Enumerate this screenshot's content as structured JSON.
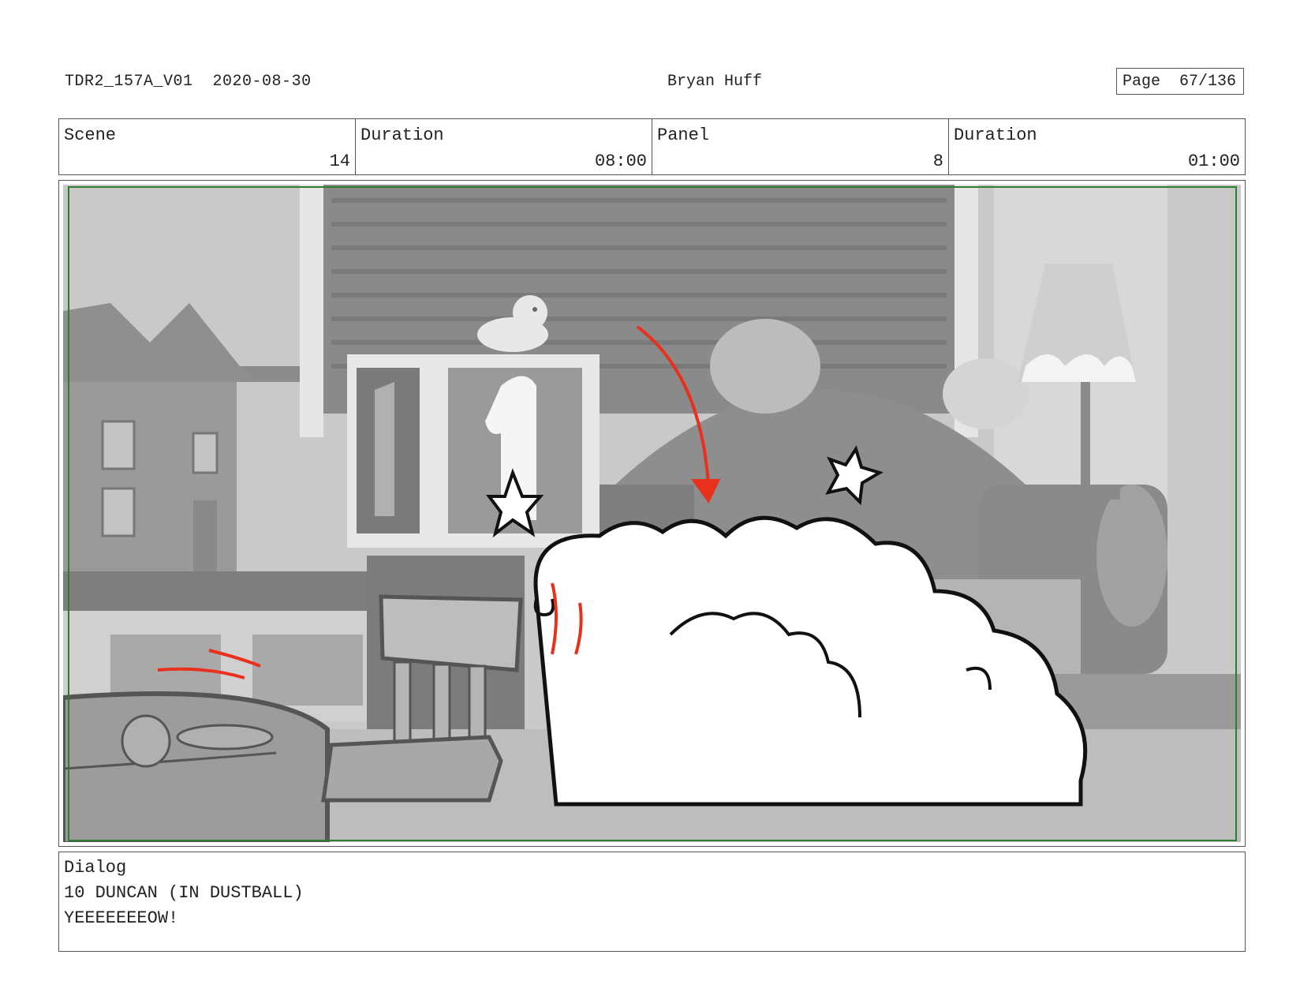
{
  "header": {
    "production_id": "TDR2_157A_V01",
    "date": "2020-08-30",
    "artist": "Bryan Huff",
    "page_label": "Page",
    "page_number": "67/136"
  },
  "info_row": {
    "scene_label": "Scene",
    "scene_value": "14",
    "scene_duration_label": "Duration",
    "scene_duration_value": "08:00",
    "panel_label": "Panel",
    "panel_value": "8",
    "panel_duration_label": "Duration",
    "panel_duration_value": "01:00"
  },
  "panel_art": {
    "description_icons": [
      "dollhouse-icon",
      "toy-blocks-icon",
      "rubber-duck-icon",
      "sofa-icon",
      "lamp-icon",
      "chair-icon",
      "table-icon",
      "dust-cloud-icon",
      "star-icon",
      "motion-arrow-icon"
    ],
    "safe_frame_color": "#2e7d2e",
    "action_color": "#e8301c"
  },
  "dialog": {
    "label": "Dialog",
    "line1": "10 DUNCAN (IN DUSTBALL)",
    "line2": "YEEEEEEEOW!"
  }
}
